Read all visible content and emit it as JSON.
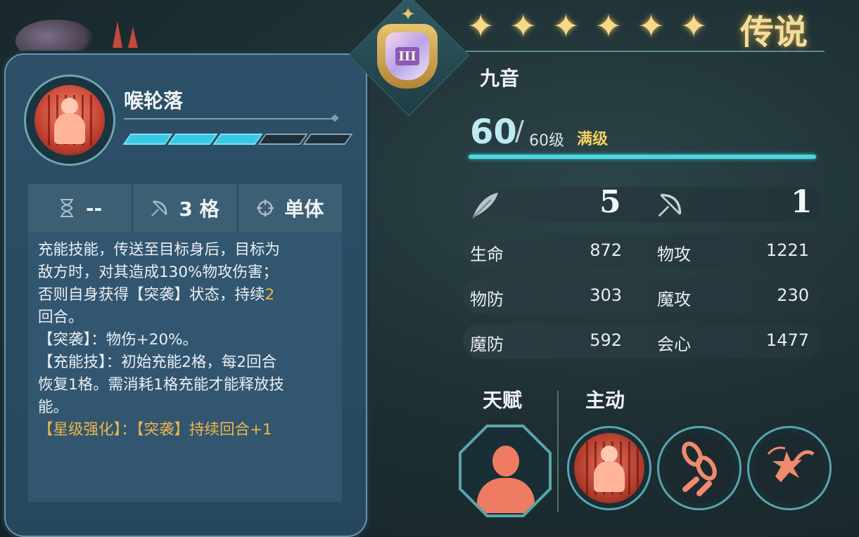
{
  "skill_card": {
    "icon": "bell-tolling-figure-icon",
    "name": "喉轮落",
    "charge": {
      "filled": 3,
      "total": 5
    },
    "cooldown_icon": "hourglass-icon",
    "cooldown_value": "--",
    "range_icon": "bow-icon",
    "range_value": "3 格",
    "target_icon": "crosshair-icon",
    "target_value": "单体",
    "desc": {
      "line1a": "充能技能，传送至目标身后，目标为",
      "line1b": "敌方时，对其造成130%物攻伤害；",
      "line1c": "否则自身获得【突袭】状态，持续",
      "line1d": "2",
      "line1e": "回合。",
      "line2": "【突袭】：物伤+20%。",
      "line3a": "【充能技】：初始充能2格，每2回合",
      "line3b": "恢复1格。需消耗1格充能才能释放技",
      "line3c": "能。",
      "line4": "【星级强化】：【突袭】持续回合+1"
    }
  },
  "character": {
    "class_badge": "III",
    "stars": 6,
    "rarity": "传说",
    "name": "九音",
    "level_current": "60",
    "level_slash": "/",
    "level_max": "60级",
    "level_badge": "满级",
    "speed_icon": "feather-icon",
    "speed": "5",
    "move_icon": "bow-icon",
    "move": "1",
    "stats": [
      {
        "label": "生命",
        "value": "872",
        "label2": "物攻",
        "value2": "1221"
      },
      {
        "label": "物防",
        "value": "303",
        "label2": "魔攻",
        "value2": "230"
      },
      {
        "label": "魔防",
        "value": "592",
        "label2": "会心",
        "value2": "1477"
      }
    ]
  },
  "abilities": {
    "talent_label": "天赋",
    "active_label": "主动",
    "talent_icon": "bust-silhouette-icon",
    "active_icons": [
      "bell-tolling-figure-icon",
      "broken-chain-icon",
      "flail-burst-icon"
    ]
  },
  "colors": {
    "accent_cyan": "#3bc8e6",
    "gold": "#f0b54a",
    "skill_red": "#e8735c"
  }
}
